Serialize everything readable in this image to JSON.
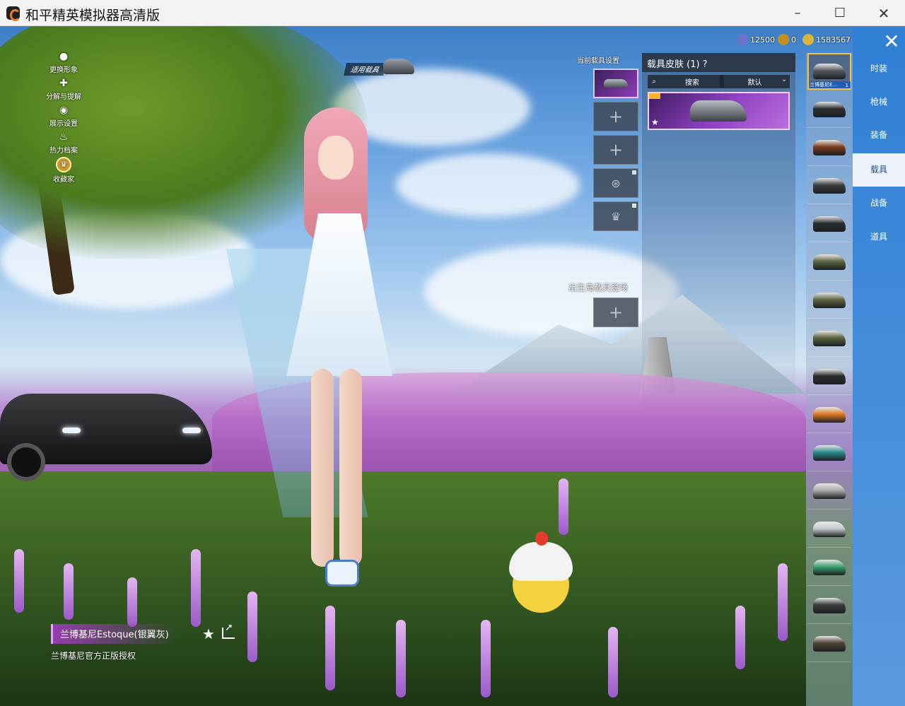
{
  "window": {
    "title": "和平精英模拟器高清版",
    "minimize": "–",
    "maximize": "☐",
    "close": "✕"
  },
  "left_menu": [
    {
      "label": "更换形象",
      "icon": "person-icon"
    },
    {
      "label": "分解与提解",
      "icon": "puzzle-icon"
    },
    {
      "label": "展示设置",
      "icon": "eye-icon"
    },
    {
      "label": "热力档案",
      "icon": "flame-icon"
    },
    {
      "label": "收藏家",
      "icon": "collector-badge-icon"
    }
  ],
  "vehicle_tag": "适用载具",
  "currency": [
    {
      "value": "12500",
      "color": "#6a74c9"
    },
    {
      "value": "0",
      "color": "#c48f1f"
    },
    {
      "value": "1583567",
      "color": "#d8b53b"
    }
  ],
  "loadout": {
    "title": "当前载具设置",
    "spawn_title": "出生岛载具登场",
    "add_symbol": "+",
    "lock_glyph": "⊛",
    "crown_glyph": "♛"
  },
  "skin_panel": {
    "title": "载具皮肤 (1) ?",
    "search_label": "搜索",
    "search_icon": "search-icon",
    "sort_label": "默认",
    "star_glyph": "★"
  },
  "vehicle_list": {
    "first_label": "兰博基尼E...",
    "first_count": "1",
    "colors": [
      "#565b62",
      "#2d2f33",
      "#7a3b1d",
      "#3b3d40",
      "#2b2c2f",
      "#5c6340",
      "#5f6644",
      "#5b613f",
      "#2b2d30",
      "#e07a24",
      "#2a8a8c",
      "#a9a9ab",
      "#c8ccd1",
      "#3aa070",
      "#383a3d",
      "#4f4336"
    ]
  },
  "tabs": [
    {
      "label": "时装",
      "active": false
    },
    {
      "label": "枪械",
      "active": false
    },
    {
      "label": "装备",
      "active": false
    },
    {
      "label": "载具",
      "active": true
    },
    {
      "label": "战备",
      "active": false
    },
    {
      "label": "道具",
      "active": false
    }
  ],
  "close_label": "✕",
  "bottom": {
    "skin_name": "兰博基尼Estoque(银翼灰)",
    "license": "兰博基尼官方正版授权",
    "star_glyph": "★"
  }
}
